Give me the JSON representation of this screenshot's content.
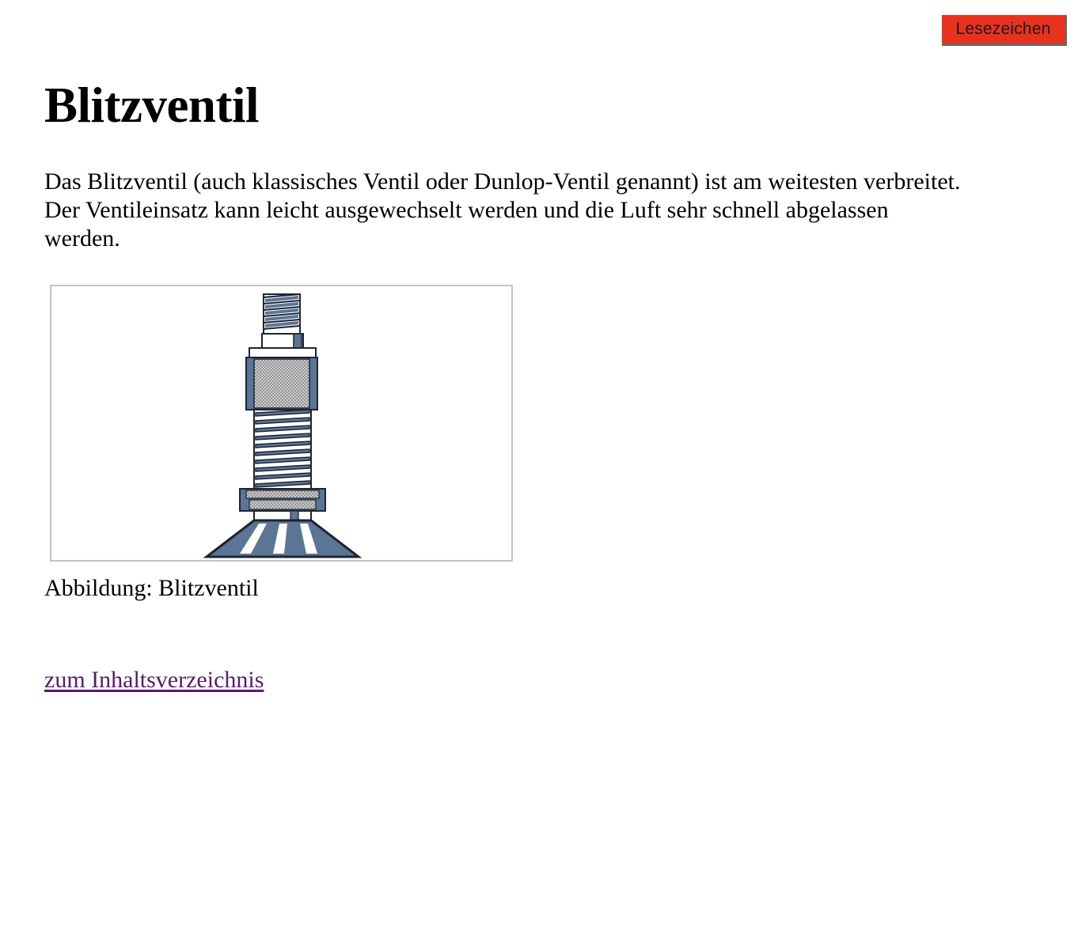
{
  "header": {
    "bookmark_label": "Lesezeichen"
  },
  "main": {
    "title": "Blitzventil",
    "intro": "Das Blitzventil (auch klassisches Ventil oder Dunlop-Ventil genannt) ist am weitesten verbreitet. Der Ventileinsatz kann leicht ausgewechselt werden und die Luft sehr schnell abgelassen werden.",
    "figure": {
      "icon": "valve-illustration",
      "caption": "Abbildung: Blitzventil"
    },
    "toc_link": "zum Inhaltsverzeichnis"
  },
  "colors": {
    "bookmark_bg": "#e8321e",
    "valve_blue": "#5b7594",
    "link_visited": "#5a1a6e"
  }
}
